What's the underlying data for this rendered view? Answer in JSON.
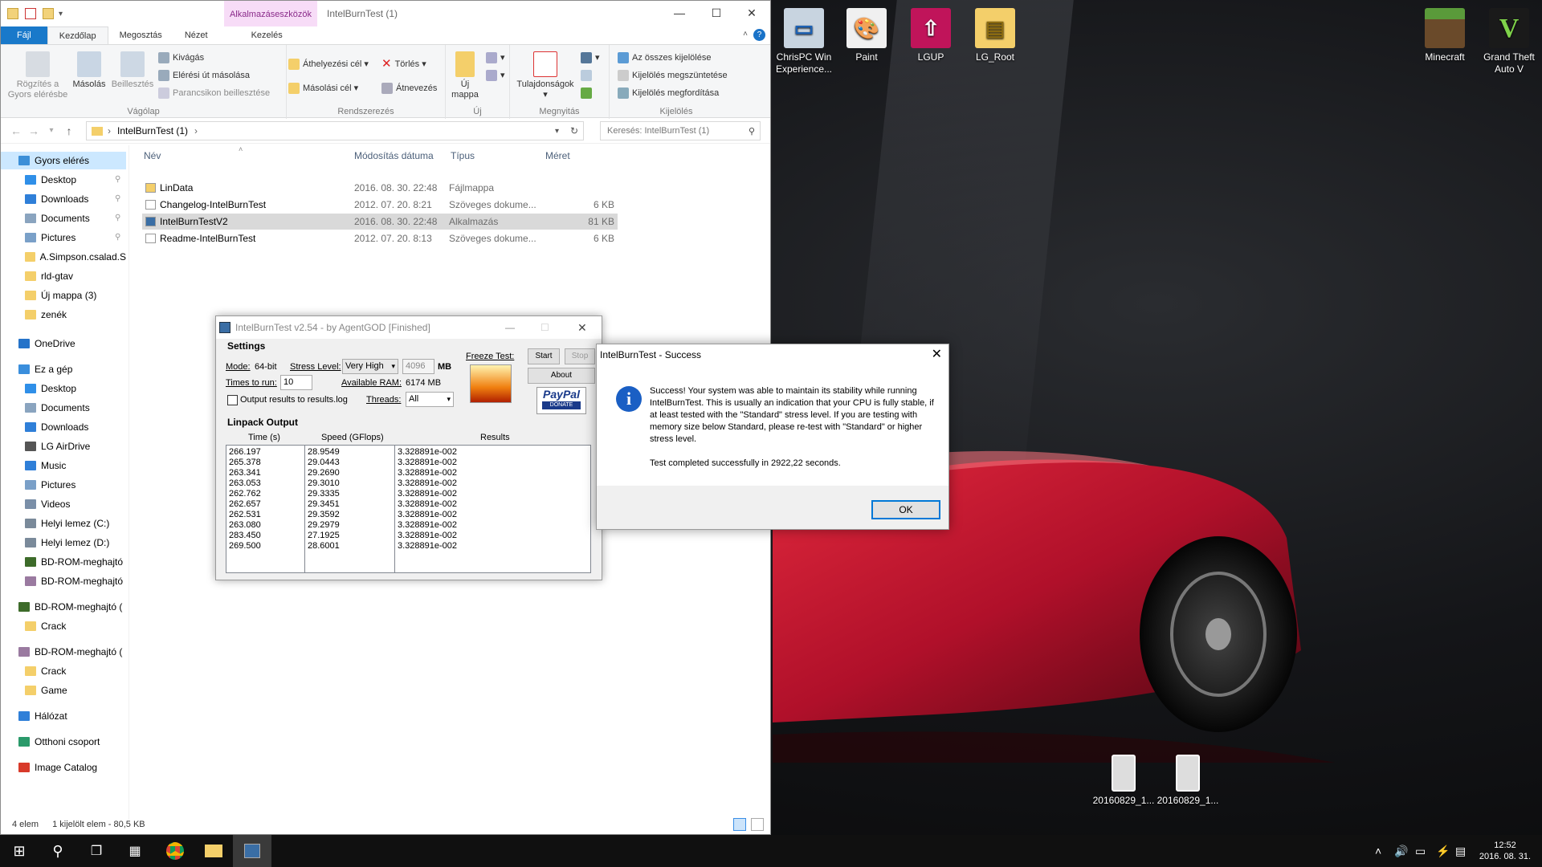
{
  "desktop": {
    "icons": [
      {
        "label": "ChrisPC Win Experience..."
      },
      {
        "label": "Paint"
      },
      {
        "label": "LGUP"
      },
      {
        "label": "LG_Root"
      },
      {
        "label": "Minecraft"
      },
      {
        "label": "Grand Theft Auto V"
      },
      {
        "label": "20160829_1..."
      },
      {
        "label": "20160829_1..."
      }
    ]
  },
  "explorer": {
    "title": "IntelBurnTest (1)",
    "context_tab": "Alkalmazáseszközök",
    "tabs": [
      "Fájl",
      "Kezdőlap",
      "Megosztás",
      "Nézet",
      "Kezelés"
    ],
    "ribbon": {
      "clipboard": {
        "label": "Vágólap",
        "pin": "Rögzítés a Gyors elérésbe",
        "copy": "Másolás",
        "paste": "Beillesztés",
        "cut": "Kivágás",
        "copy_path": "Elérési út másolása",
        "paste_shortcut": "Parancsikon beillesztése"
      },
      "organize": {
        "label": "Rendszerezés",
        "move_to": "Áthelyezési cél",
        "copy_to": "Másolási cél",
        "delete": "Törlés",
        "rename": "Átnevezés"
      },
      "new": {
        "label": "Új",
        "new_folder": "Új mappa"
      },
      "open": {
        "label": "Megnyitás",
        "properties": "Tulajdonságok"
      },
      "select": {
        "label": "Kijelölés",
        "select_all": "Az összes kijelölése",
        "select_none": "Kijelölés megszüntetése",
        "invert": "Kijelölés megfordítása"
      }
    },
    "address": {
      "path": "IntelBurnTest (1)",
      "search_placeholder": "Keresés: IntelBurnTest (1)"
    },
    "nav": [
      {
        "label": "Gyors elérés",
        "color": "#3c8fd8",
        "pinned": false
      },
      {
        "label": "Desktop",
        "color": "#2f8fe8",
        "pinned": true
      },
      {
        "label": "Downloads",
        "color": "#2f7fd8",
        "pinned": true
      },
      {
        "label": "Documents",
        "color": "#8aa4bf",
        "pinned": true
      },
      {
        "label": "Pictures",
        "color": "#7aa0c8",
        "pinned": true
      },
      {
        "label": "A.Simpson.csalad.S",
        "color": "#f4cf6a",
        "pinned": false
      },
      {
        "label": "rld-gtav",
        "color": "#f4cf6a",
        "pinned": false
      },
      {
        "label": "Új mappa (3)",
        "color": "#f4cf6a",
        "pinned": false
      },
      {
        "label": "zenék",
        "color": "#f4cf6a",
        "pinned": false
      },
      {
        "label": "OneDrive",
        "color": "#2573c9",
        "pinned": false
      },
      {
        "label": "Ez a gép",
        "color": "#3a8edc",
        "pinned": false
      },
      {
        "label": "Desktop",
        "color": "#2f8fe8",
        "pinned": false
      },
      {
        "label": "Documents",
        "color": "#8aa4bf",
        "pinned": false
      },
      {
        "label": "Downloads",
        "color": "#2f7fd8",
        "pinned": false
      },
      {
        "label": "LG AirDrive",
        "color": "#555555",
        "pinned": false
      },
      {
        "label": "Music",
        "color": "#2f7fd8",
        "pinned": false
      },
      {
        "label": "Pictures",
        "color": "#7aa0c8",
        "pinned": false
      },
      {
        "label": "Videos",
        "color": "#7a8fa8",
        "pinned": false
      },
      {
        "label": "Helyi lemez (C:)",
        "color": "#7a8a9a",
        "pinned": false
      },
      {
        "label": "Helyi lemez (D:)",
        "color": "#7a8a9a",
        "pinned": false
      },
      {
        "label": "BD-ROM-meghajtó",
        "color": "#3d6b2a",
        "pinned": false
      },
      {
        "label": "BD-ROM-meghajtó",
        "color": "#9a7aa0",
        "pinned": false
      },
      {
        "label": "BD-ROM-meghajtó (",
        "color": "#3d6b2a",
        "pinned": false
      },
      {
        "label": "Crack",
        "color": "#f4cf6a",
        "pinned": false
      },
      {
        "label": "BD-ROM-meghajtó (",
        "color": "#9a7aa0",
        "pinned": false
      },
      {
        "label": "Crack",
        "color": "#f4cf6a",
        "pinned": false
      },
      {
        "label": "Game",
        "color": "#f4cf6a",
        "pinned": false
      },
      {
        "label": "Hálózat",
        "color": "#2f7fd8",
        "pinned": false
      },
      {
        "label": "Otthoni csoport",
        "color": "#2a9a6a",
        "pinned": false
      },
      {
        "label": "Image Catalog",
        "color": "#d83a2a",
        "pinned": false
      }
    ],
    "columns": [
      "Név",
      "Módosítás dátuma",
      "Típus",
      "Méret"
    ],
    "files": [
      {
        "name": "LinData",
        "date": "2016. 08. 30. 22:48",
        "type": "Fájlmappa",
        "size": "",
        "color": "#f4cf6a",
        "selected": false
      },
      {
        "name": "Changelog-IntelBurnTest",
        "date": "2012. 07. 20. 8:21",
        "type": "Szöveges dokume...",
        "size": "6 KB",
        "color": "#ffffff",
        "selected": false
      },
      {
        "name": "IntelBurnTestV2",
        "date": "2016. 08. 30. 22:48",
        "type": "Alkalmazás",
        "size": "81 KB",
        "color": "#3a6ea5",
        "selected": true
      },
      {
        "name": "Readme-IntelBurnTest",
        "date": "2012. 07. 20. 8:13",
        "type": "Szöveges dokume...",
        "size": "6 KB",
        "color": "#ffffff",
        "selected": false
      }
    ],
    "status": {
      "count": "4 elem",
      "selected": "1 kijelölt elem - 80,5 KB"
    }
  },
  "ibt": {
    "title": "IntelBurnTest v2.54 - by AgentGOD [Finished]",
    "settings_label": "Settings",
    "mode_label": "Mode:",
    "mode_value": "64-bit",
    "stress_label": "Stress Level:",
    "stress_value": "Very High",
    "mem_value": "4096",
    "mem_unit": "MB",
    "times_label": "Times to run:",
    "times_value": "10",
    "ram_label": "Available RAM:",
    "ram_value": "6174 MB",
    "log_label": "Output results to results.log",
    "threads_label": "Threads:",
    "threads_value": "All",
    "freeze_label": "Freeze Test:",
    "start": "Start",
    "stop": "Stop",
    "about": "About",
    "paypal": "PayPal",
    "donate": "DONATE",
    "output_label": "Linpack Output",
    "headers": [
      "Time (s)",
      "Speed (GFlops)",
      "Results"
    ],
    "times": [
      "266.197",
      "265.378",
      "263.341",
      "263.053",
      "262.762",
      "262.657",
      "262.531",
      "263.080",
      "283.450",
      "269.500"
    ],
    "speeds": [
      "28.9549",
      "29.0443",
      "29.2690",
      "29.3010",
      "29.3335",
      "29.3451",
      "29.3592",
      "29.2979",
      "27.1925",
      "28.6001"
    ],
    "results": [
      "3.328891e-002",
      "3.328891e-002",
      "3.328891e-002",
      "3.328891e-002",
      "3.328891e-002",
      "3.328891e-002",
      "3.328891e-002",
      "3.328891e-002",
      "3.328891e-002",
      "3.328891e-002"
    ]
  },
  "dialog": {
    "title": "IntelBurnTest - Success",
    "message": "Success! Your system was able to maintain its stability while running IntelBurnTest. This is usually an indication that your CPU is fully stable, if at least tested with the \"Standard\" stress level. If you are testing with memory size below Standard, please re-test with \"Standard\" or higher stress level.",
    "completed": "Test completed successfully in 2922,22 seconds.",
    "ok": "OK"
  },
  "taskbar": {
    "time": "12:52",
    "date": "2016. 08. 31."
  }
}
